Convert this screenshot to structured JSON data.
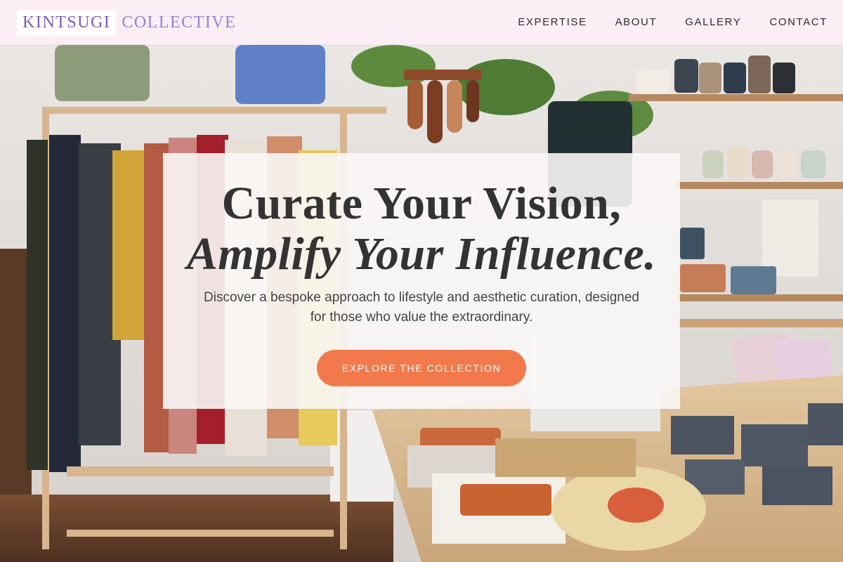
{
  "brand": {
    "part1": "KINTSUGI",
    "part2": "COLLECTIVE"
  },
  "nav": {
    "items": [
      {
        "label": "EXPERTISE"
      },
      {
        "label": "ABOUT"
      },
      {
        "label": "GALLERY"
      },
      {
        "label": "CONTACT"
      }
    ]
  },
  "hero": {
    "headline_line1": "Curate Your Vision,",
    "headline_line2": "Amplify Your Influence.",
    "subtext": "Discover a bespoke approach to lifestyle and aesthetic curation, designed for those who value the extraordinary.",
    "cta_label": "EXPLORE THE COLLECTION",
    "background_description": "boutique-interior-photo"
  },
  "colors": {
    "header_bg": "#fbeef4",
    "brand_purple": "#7d5cb8",
    "cta_orange": "#f2794b",
    "text_dark": "#333333"
  }
}
